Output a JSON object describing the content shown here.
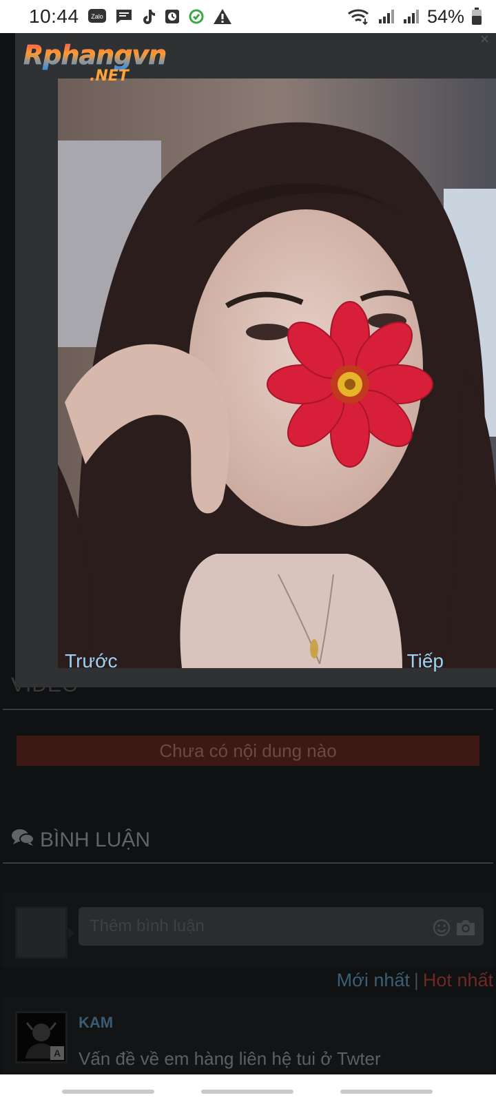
{
  "status_bar": {
    "time": "10:44",
    "notification_icons": [
      "zalo-icon",
      "message-icon",
      "tiktok-icon",
      "clock-app-icon",
      "sync-icon",
      "warning-icon"
    ],
    "battery_percent": "54%",
    "zalo_label": "Zalo"
  },
  "lightbox": {
    "logo_main": "Rphangvn",
    "logo_sub": ".NET",
    "prev_label": "Trước",
    "next_label": "Tiếp",
    "close_glyph": "×"
  },
  "page": {
    "video_heading": "VIDEO",
    "empty_message": "Chưa có nội dung nào",
    "comments_heading": "BÌNH LUẬN",
    "comment_placeholder": "Thêm bình luận",
    "sort": {
      "newest": "Mới nhất",
      "separator": "|",
      "hot": "Hot nhất"
    },
    "comments": [
      {
        "user": "KAM",
        "text": "Vấn đề về em hàng liên hệ tui ở Twter",
        "badge": "A"
      }
    ]
  },
  "colors": {
    "link": "#9ad3f5",
    "banner_bg": "#3d1914",
    "hot_tab": "#6e2a22",
    "newest_tab": "#3c5f77"
  }
}
